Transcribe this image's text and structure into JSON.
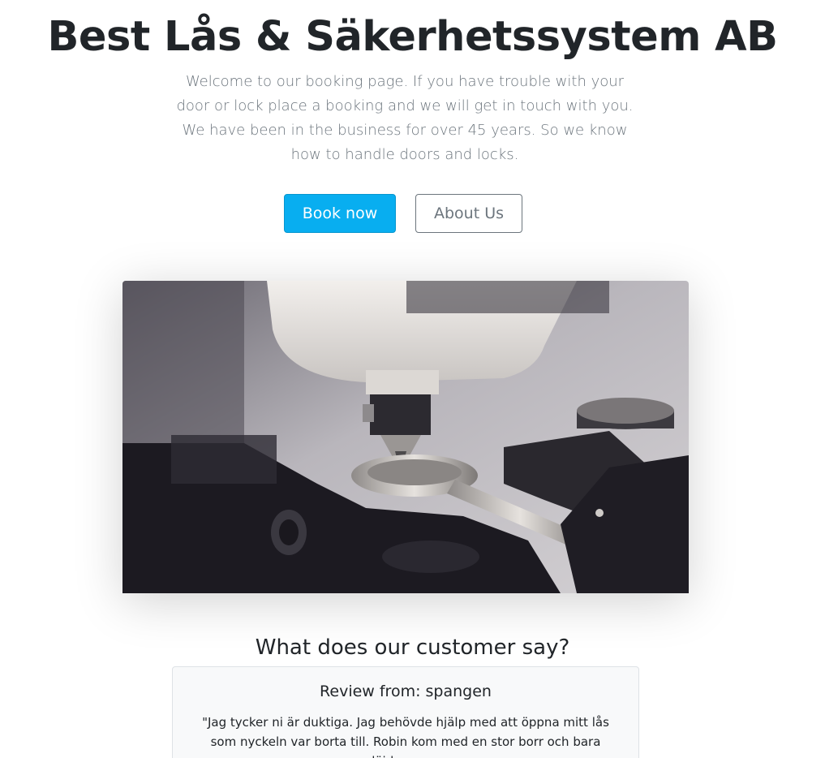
{
  "hero": {
    "title": "Best Lås & Säkerhetssystem AB",
    "lead": "Welcome to our booking page. If you have trouble with your door or lock place a booking and we will get in touch with you. We have been in the business for over 45 years. So we know how to handle doors and locks."
  },
  "buttons": {
    "book_label": "Book now",
    "about_label": "About Us"
  },
  "colors": {
    "primary": "#08aef0",
    "muted": "#6c757d",
    "text": "#212529",
    "card_bg": "#f8f9fa"
  },
  "reviews": {
    "section_title": "What does our customer say?",
    "items": [
      {
        "heading": "Review from: spangen",
        "text": "\"Jag tycker ni är duktiga. Jag behövde hjälp med att öppna mitt lås som nyckeln var borta till. Robin kom med en stor borr och bara plöjde genom"
      }
    ]
  }
}
